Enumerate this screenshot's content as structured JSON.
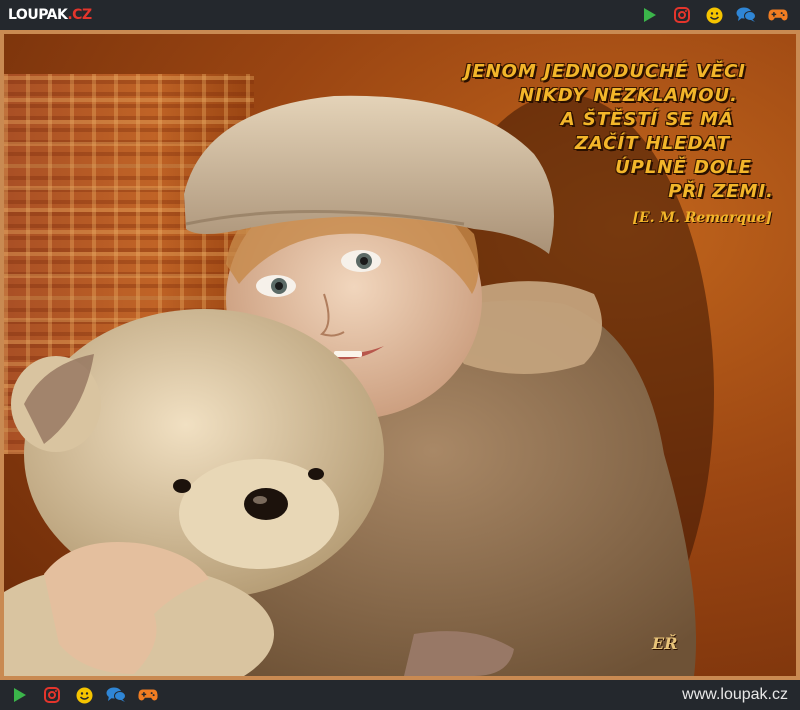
{
  "header": {
    "logo_main": "Loupak",
    "logo_tld": ".cz"
  },
  "nav_icons": [
    {
      "name": "play-icon",
      "color": "#3bb54a"
    },
    {
      "name": "instagram-icon",
      "color": "#e4352c"
    },
    {
      "name": "smiley-icon",
      "color": "#f5c400"
    },
    {
      "name": "chat-icon",
      "color": "#2f86d6"
    },
    {
      "name": "gamepad-icon",
      "color": "#f07d22"
    }
  ],
  "image": {
    "quote_lines": [
      "Jenom jednoduché věci",
      "nikdy nezklamou.",
      "A štěstí se má",
      "začít hledat",
      "úplně dole",
      "při zemi."
    ],
    "author": "[E. M. Remarque]",
    "signature": "EŘ"
  },
  "footer": {
    "site_url": "www.loupak.cz"
  },
  "colors": {
    "bar_bg": "#24282d",
    "frame": "#c98a52",
    "quote_text": "#f3b62a"
  }
}
